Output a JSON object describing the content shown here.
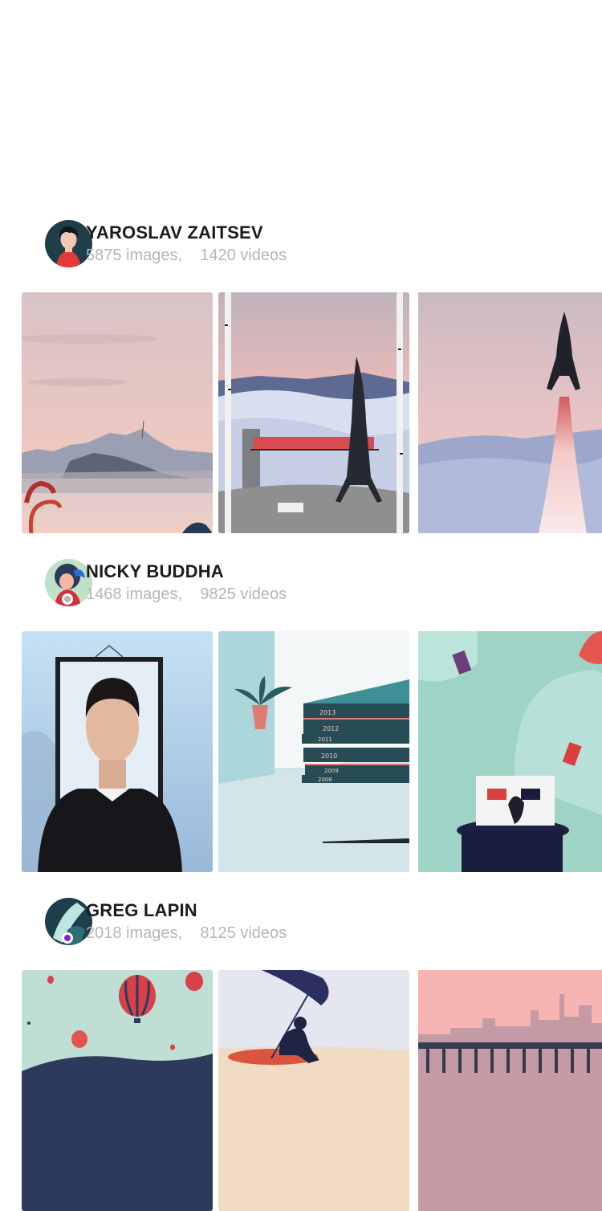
{
  "profiles": [
    {
      "name": "YAROSLAV ZAITSEV",
      "images": "5875 images,",
      "videos": "1420 videos",
      "status": null
    },
    {
      "name": "NICKY BUDDHA",
      "images": "1468 images,",
      "videos": "9825 videos",
      "status": "#b3b3b3"
    },
    {
      "name": "GREG LAPIN",
      "images": "2018 images,",
      "videos": "8125 videos",
      "status": "#7b22e8"
    }
  ],
  "book_years": [
    "2013",
    "2012",
    "2011",
    "2010",
    "2009",
    "2008"
  ]
}
